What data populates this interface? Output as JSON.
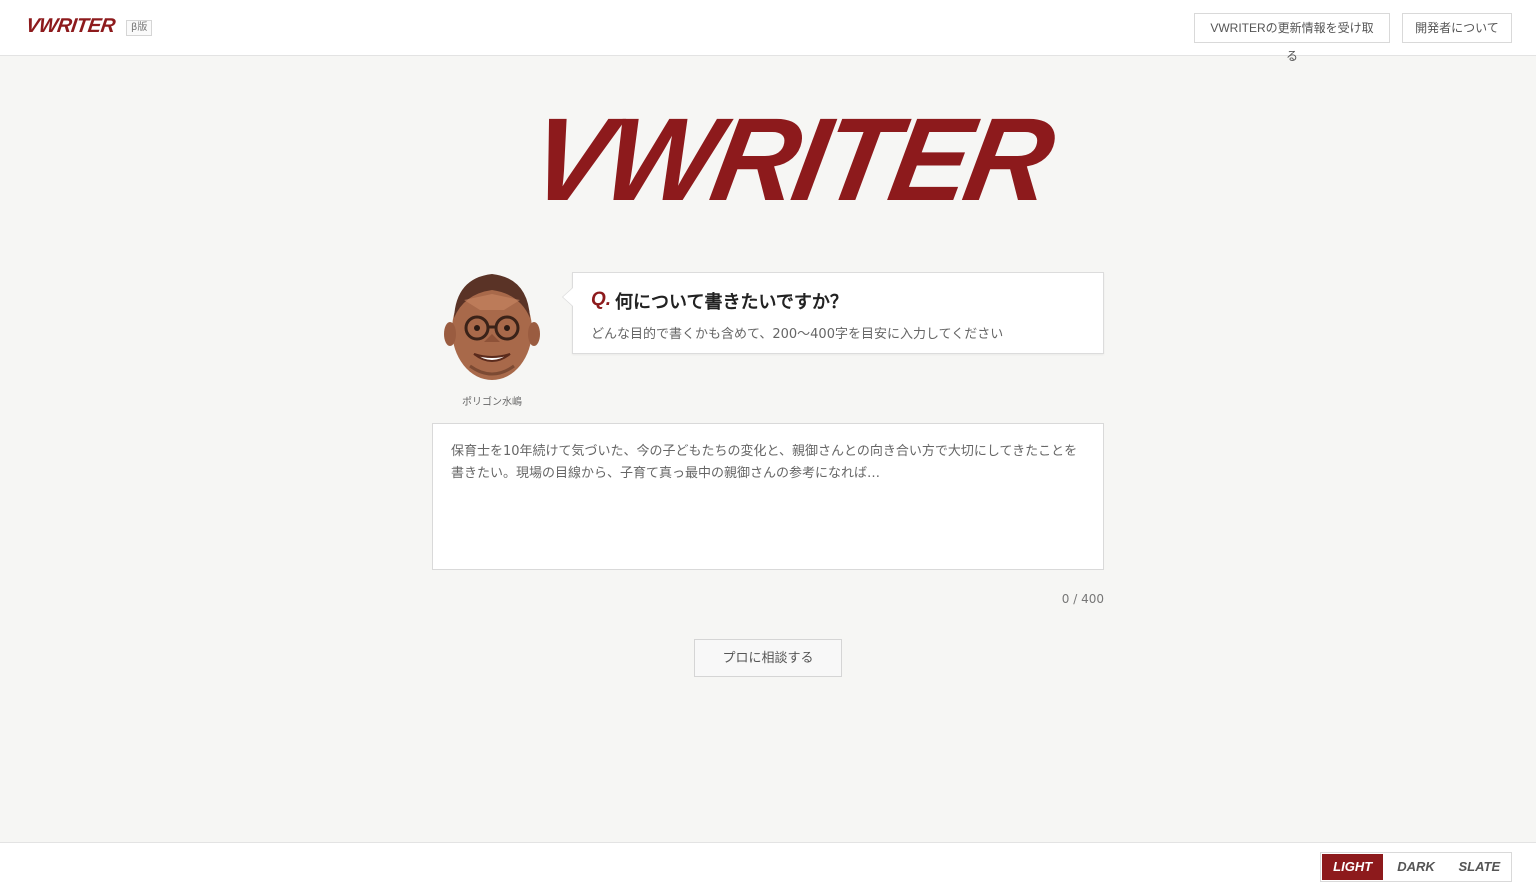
{
  "header": {
    "brand": "VWRITER",
    "beta_badge": "β版",
    "updates_label": "VWRITERの更新情報を受け取る",
    "about_label": "開発者について"
  },
  "hero": {
    "logo_text": "VWRITER"
  },
  "advisor": {
    "name": "ポリゴン水嶋",
    "question_mark": "Q.",
    "question": "何について書きたいですか？",
    "hint": "どんな目的で書くかも含めて、200〜400字を目安に入力してください"
  },
  "answer": {
    "value": "",
    "placeholder": "保育士を10年続けて気づいた、今の子どもたちの変化と、親御さんとの向き合い方で大切にしてきたことを書きたい。現場の目線から、子育て真っ最中の親御さんの参考になれば…",
    "counter": "0 / 400"
  },
  "actions": {
    "consult_label": "プロに相談する"
  },
  "footer": {
    "themes": [
      "LIGHT",
      "DARK",
      "SLATE"
    ],
    "active_theme": "LIGHT"
  },
  "colors": {
    "brand_red": "#8d1a1c",
    "background": "#f6f6f4"
  }
}
